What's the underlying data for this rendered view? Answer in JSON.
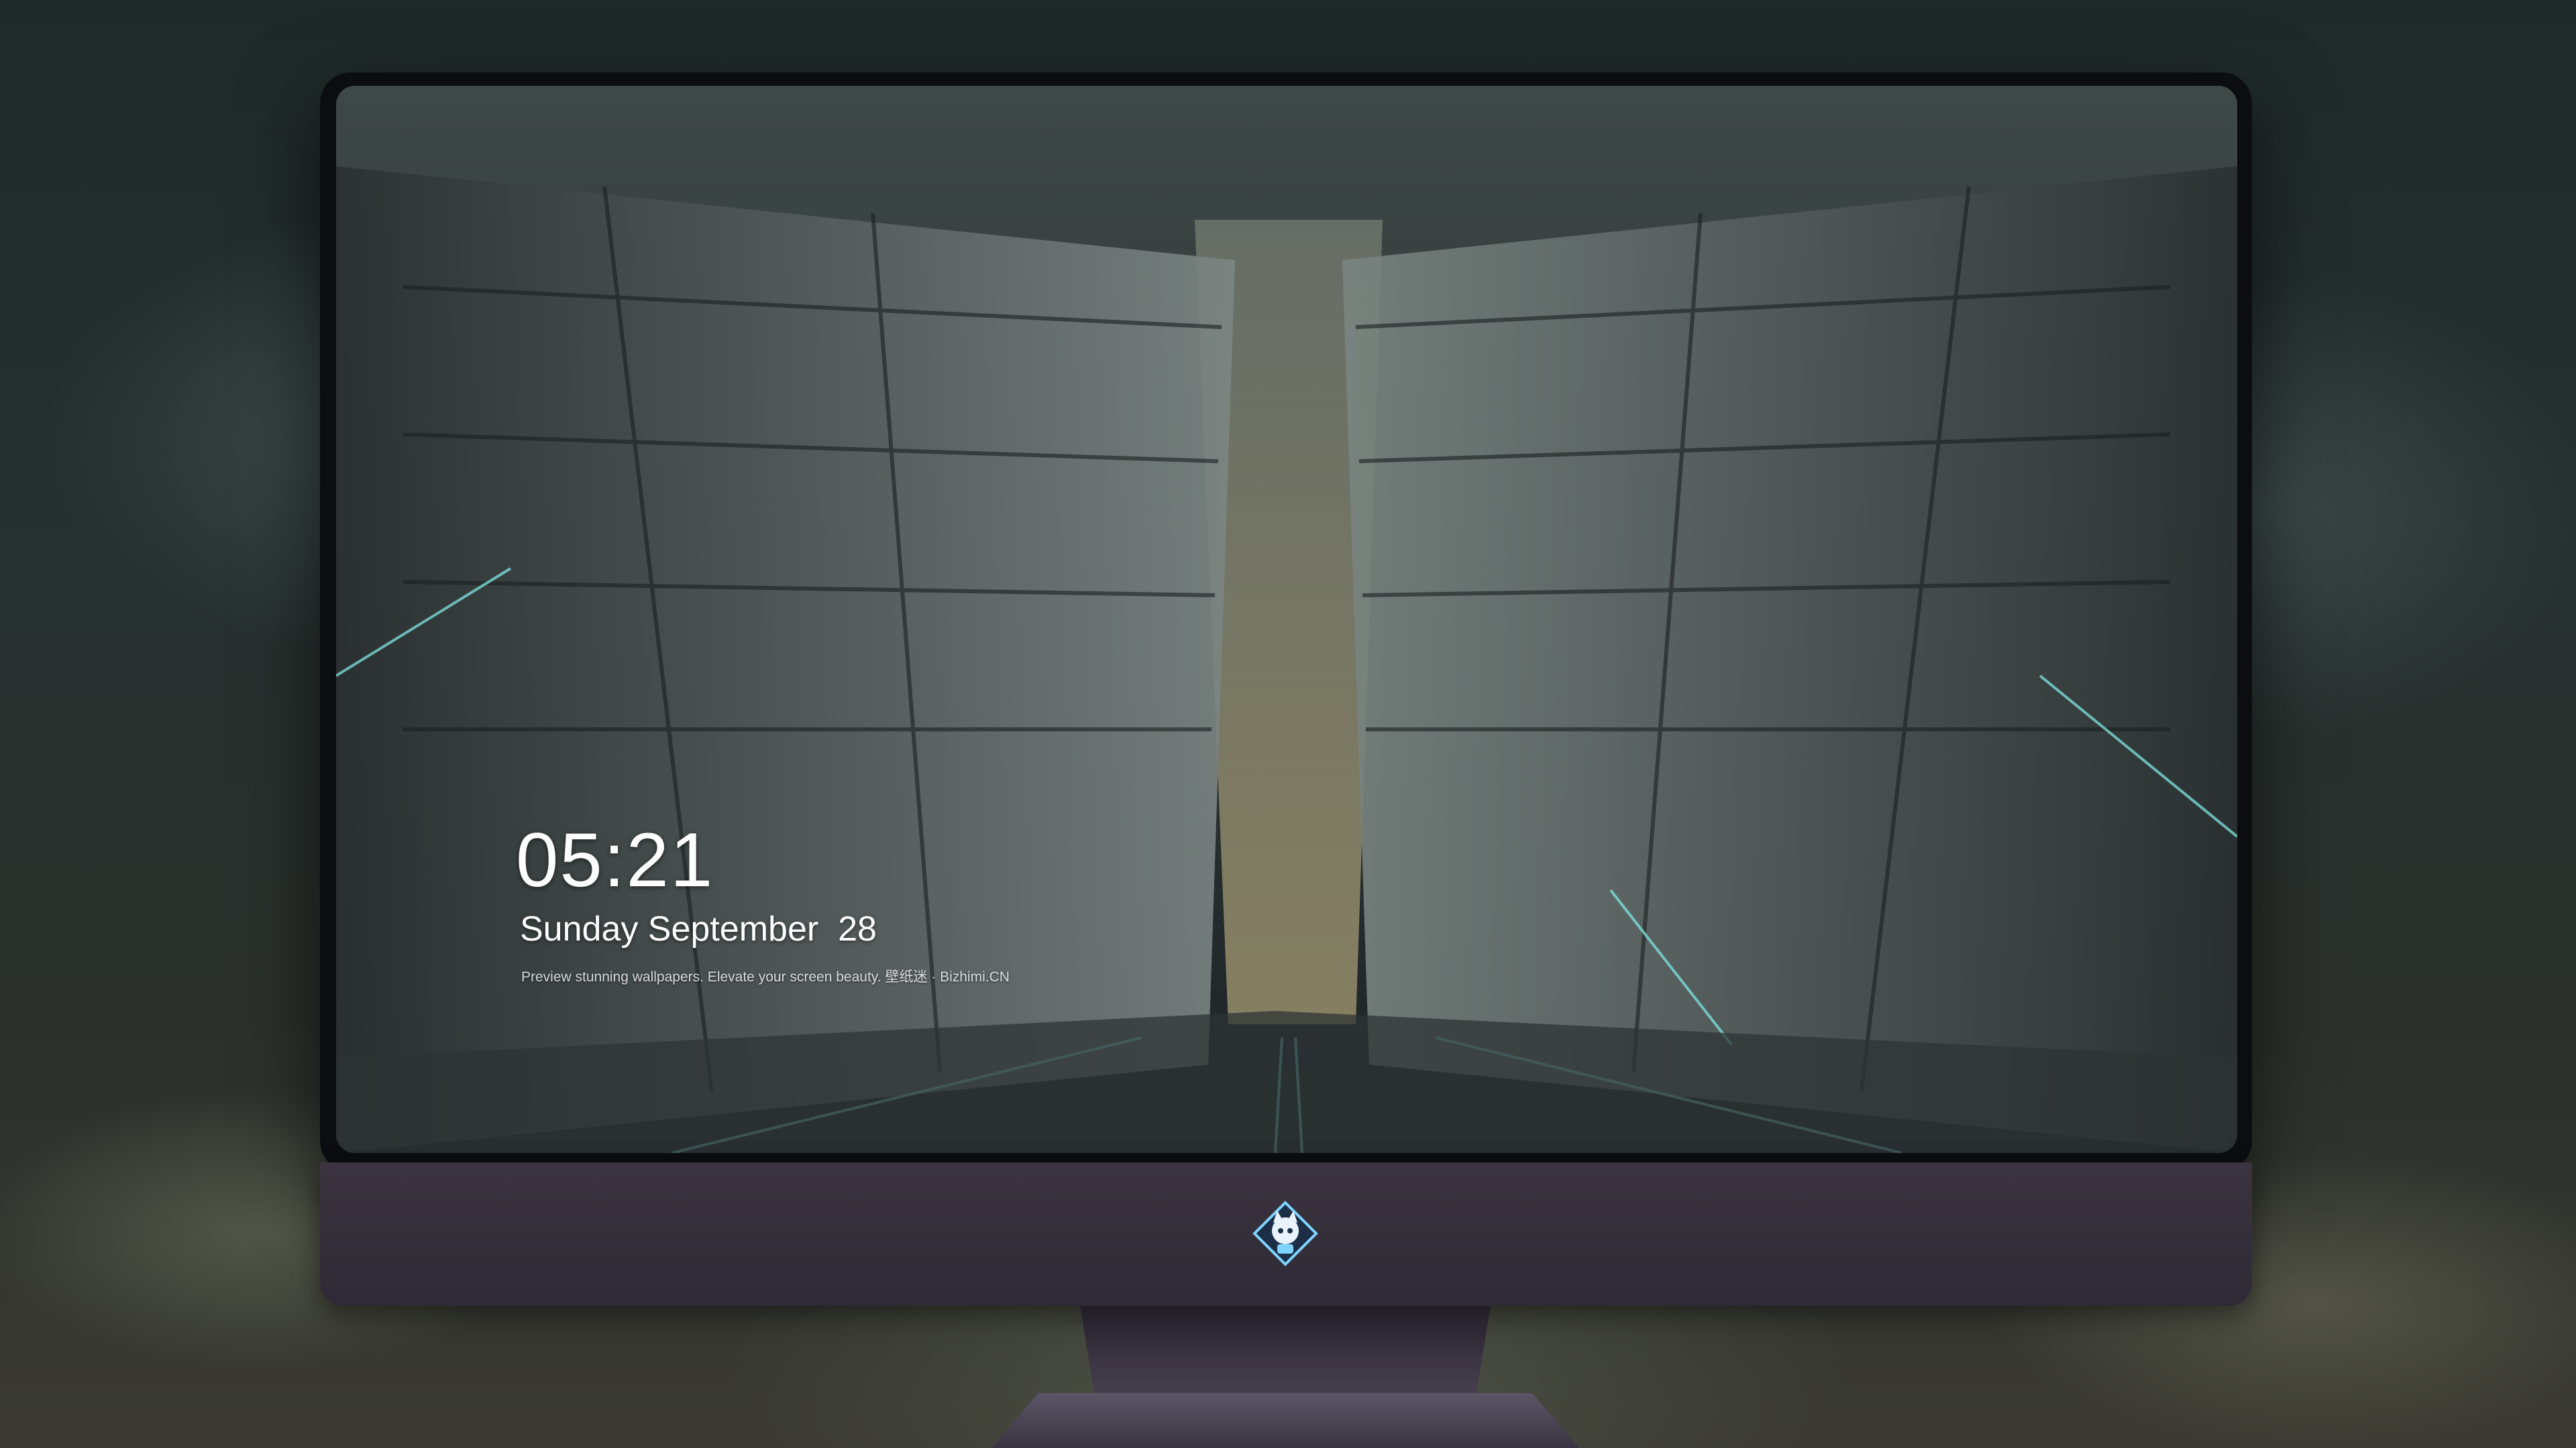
{
  "lockscreen": {
    "time": "05:21",
    "date": "Sunday September  28",
    "caption": "Preview stunning wallpapers. Elevate your screen beauty. 壁纸迷 · Bizhimi.CN"
  },
  "dock": {
    "apps": [
      {
        "name": "messages-icon",
        "glyph": "💬",
        "color": "#34c759"
      },
      {
        "name": "weather-icon",
        "glyph": "⛅",
        "color": "#2f8fe8"
      },
      {
        "name": "clock-icon",
        "glyph": "🕔",
        "color": "#f2f2f2"
      },
      {
        "name": "maps-icon",
        "glyph": "🗺",
        "color": "#e6d38a"
      },
      {
        "name": "clips-icon",
        "glyph": "🎬",
        "color": "#4fd1e0"
      },
      {
        "name": "notes-icon",
        "glyph": "📝",
        "color": "#ffe27a"
      },
      {
        "name": "photos-icon",
        "glyph": "🖼",
        "color": "#7fcf6a"
      },
      {
        "name": "music-icon",
        "glyph": "♫",
        "color": "#e35cd8"
      },
      {
        "name": "app-store-icon",
        "glyph": "Ⓐ",
        "color": "#1e8ff5"
      },
      {
        "name": "camera-icon",
        "glyph": "📷",
        "color": "#9a9a9a"
      }
    ]
  },
  "brand_logo": "bizhimi-mascot-logo"
}
